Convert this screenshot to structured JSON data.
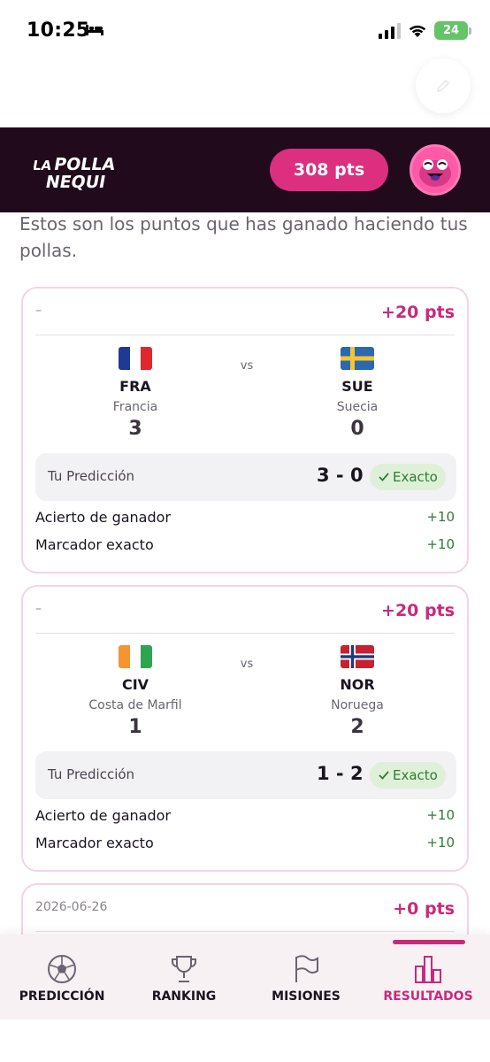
{
  "status_bar": {
    "time": "10:25",
    "battery": "24"
  },
  "header": {
    "logo_text": "LA POLLA NEQUI",
    "points": "308 pts"
  },
  "intro_text": "Estos son los puntos que has ganado haciendo tus pollas.",
  "matches": [
    {
      "date": "–",
      "points": "+20 pts",
      "home": {
        "code": "FRA",
        "name": "Francia",
        "score": "3"
      },
      "away": {
        "code": "SUE",
        "name": "Suecia",
        "score": "0"
      },
      "vs": "vs",
      "prediction_label": "Tu Predicción",
      "prediction_score": "3 - 0",
      "badge": "Exacto",
      "bonuses": [
        {
          "label": "Acierto de ganador",
          "value": "+10"
        },
        {
          "label": "Marcador exacto",
          "value": "+10"
        }
      ]
    },
    {
      "date": "–",
      "points": "+20 pts",
      "home": {
        "code": "CIV",
        "name": "Costa de Marfil",
        "score": "1"
      },
      "away": {
        "code": "NOR",
        "name": "Noruega",
        "score": "2"
      },
      "vs": "vs",
      "prediction_label": "Tu Predicción",
      "prediction_score": "1 - 2",
      "badge": "Exacto",
      "bonuses": [
        {
          "label": "Acierto de ganador",
          "value": "+10"
        },
        {
          "label": "Marcador exacto",
          "value": "+10"
        }
      ]
    },
    {
      "date": "2026-06-26",
      "points": "+0 pts"
    }
  ],
  "nav": [
    {
      "label": "PREDICCIÓN",
      "icon": "soccer-ball-icon"
    },
    {
      "label": "RANKING",
      "icon": "trophy-icon"
    },
    {
      "label": "MISIONES",
      "icon": "flag-icon"
    },
    {
      "label": "RESULTADOS",
      "icon": "bar-chart-icon",
      "active": true
    }
  ],
  "colors": {
    "accent": "#c72a7c",
    "header_bg": "#200a1c",
    "success": "#2e7d32"
  }
}
